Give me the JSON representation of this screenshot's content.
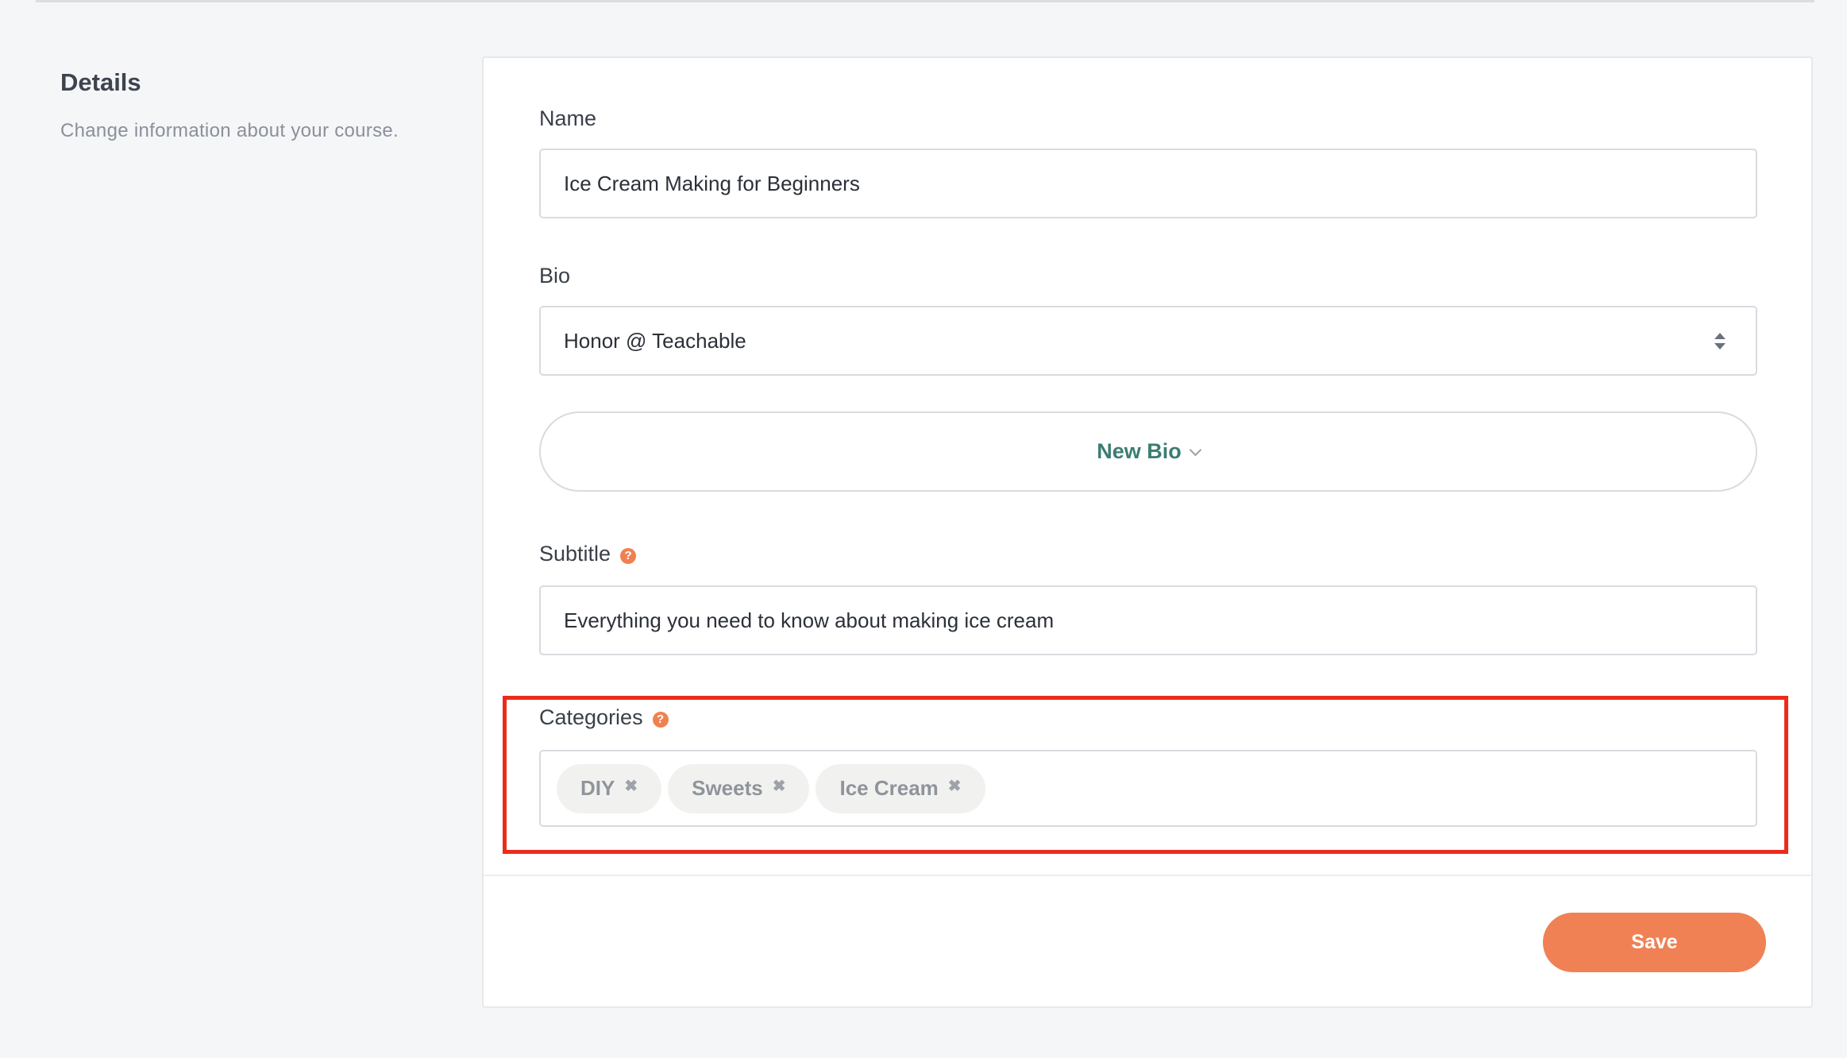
{
  "details": {
    "title": "Details",
    "description": "Change information about your course."
  },
  "form": {
    "name_label": "Name",
    "name_value": "Ice Cream Making for Beginners",
    "bio_label": "Bio",
    "bio_selected": "Honor @ Teachable",
    "new_bio_label": "New Bio",
    "subtitle_label": "Subtitle",
    "subtitle_value": "Everything you need to know about making ice cream",
    "categories_label": "Categories",
    "categories": [
      {
        "label": "DIY",
        "remove": "✖"
      },
      {
        "label": "Sweets",
        "remove": "✖"
      },
      {
        "label": "Ice Cream",
        "remove": "✖"
      }
    ],
    "help_glyph": "?"
  },
  "actions": {
    "save_label": "Save"
  },
  "colors": {
    "accent_orange": "#f08154",
    "link_green": "#3b7d72",
    "highlight_red": "#ec2c1b",
    "page_bg": "#f5f6f7"
  },
  "icons": {
    "help": "help-circle-icon",
    "select": "select-arrows-icon",
    "chevron": "chevron-down-icon",
    "remove": "remove-tag-icon"
  }
}
